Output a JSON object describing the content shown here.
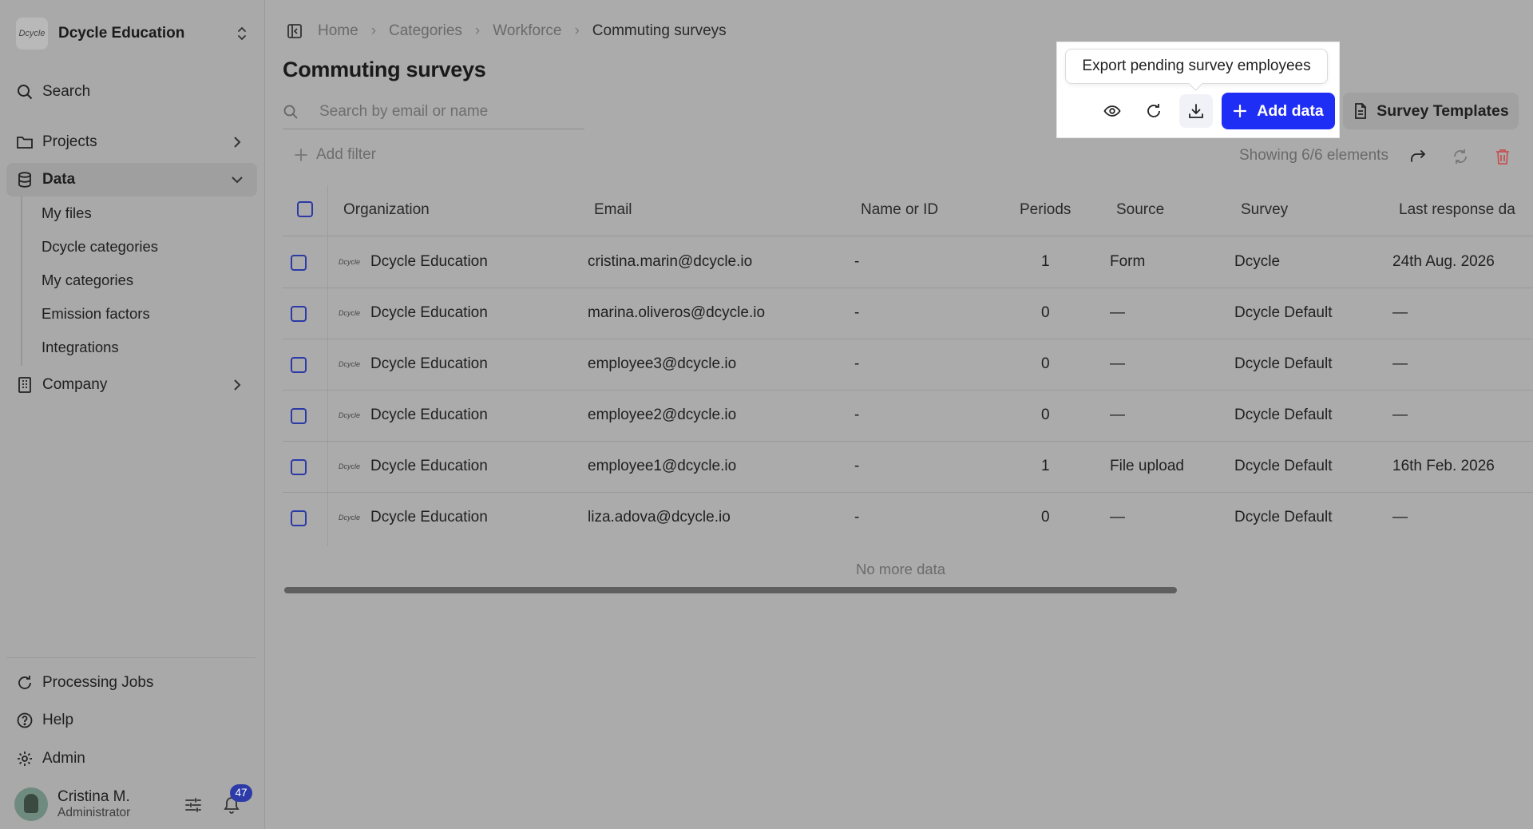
{
  "sidebar": {
    "org_logo_text": "Dcycle",
    "org_name": "Dcycle Education",
    "search": "Search",
    "projects": "Projects",
    "data": "Data",
    "sub_items": [
      "My files",
      "Dcycle categories",
      "My categories",
      "Emission factors",
      "Integrations"
    ],
    "company": "Company",
    "processing_jobs": "Processing Jobs",
    "help": "Help",
    "admin": "Admin",
    "user_name": "Cristina M.",
    "user_role": "Administrator",
    "notifications": "47"
  },
  "breadcrumb": [
    "Home",
    "Categories",
    "Workforce",
    "Commuting surveys"
  ],
  "page_title": "Commuting surveys",
  "search_placeholder": "Search by email or name",
  "tooltip": "Export pending survey employees",
  "add_data": "Add data",
  "survey_templates": "Survey Templates",
  "add_filter": "Add filter",
  "showing": "Showing 6/6 elements",
  "columns": [
    "Organization",
    "Email",
    "Name or ID",
    "Periods",
    "Source",
    "Survey",
    "Last response da"
  ],
  "rows": [
    {
      "org": "Dcycle Education",
      "email": "cristina.marin@dcycle.io",
      "name": "-",
      "periods": "1",
      "source": "Form",
      "survey": "Dcycle",
      "last": "24th Aug. 2026"
    },
    {
      "org": "Dcycle Education",
      "email": "marina.oliveros@dcycle.io",
      "name": "-",
      "periods": "0",
      "source": "—",
      "survey": "Dcycle Default",
      "last": "—"
    },
    {
      "org": "Dcycle Education",
      "email": "employee3@dcycle.io",
      "name": "-",
      "periods": "0",
      "source": "—",
      "survey": "Dcycle Default",
      "last": "—"
    },
    {
      "org": "Dcycle Education",
      "email": "employee2@dcycle.io",
      "name": "-",
      "periods": "0",
      "source": "—",
      "survey": "Dcycle Default",
      "last": "—"
    },
    {
      "org": "Dcycle Education",
      "email": "employee1@dcycle.io",
      "name": "-",
      "periods": "1",
      "source": "File upload",
      "survey": "Dcycle Default",
      "last": "16th Feb. 2026"
    },
    {
      "org": "Dcycle Education",
      "email": "liza.adova@dcycle.io",
      "name": "-",
      "periods": "0",
      "source": "—",
      "survey": "Dcycle Default",
      "last": "—"
    }
  ],
  "no_more": "No more data",
  "colors": {
    "primary": "#1f2ef5",
    "badge": "#2c3ba8",
    "overlay": "#ababab"
  }
}
